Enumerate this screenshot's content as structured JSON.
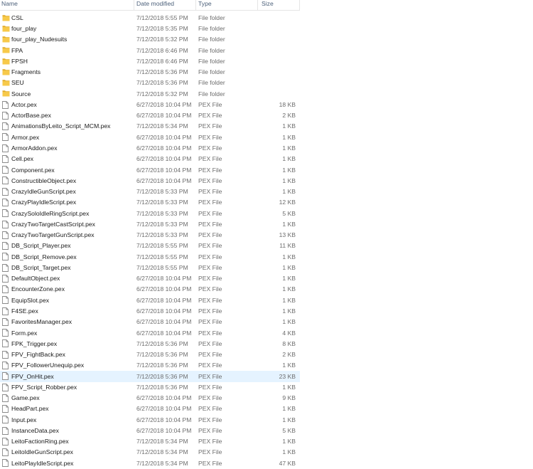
{
  "columns": {
    "name": "Name",
    "date": "Date modified",
    "type": "Type",
    "size": "Size"
  },
  "selected_index": 33,
  "colors": {
    "folder": "#f7c94a",
    "folder_dark": "#e0ab2b",
    "selection": "#e5f3ff"
  },
  "files": [
    {
      "name": "CSL",
      "date": "7/12/2018 5:55 PM",
      "type": "File folder",
      "size": "",
      "kind": "folder"
    },
    {
      "name": "four_play",
      "date": "7/12/2018 5:35 PM",
      "type": "File folder",
      "size": "",
      "kind": "folder"
    },
    {
      "name": "four_play_Nudesuits",
      "date": "7/12/2018 5:32 PM",
      "type": "File folder",
      "size": "",
      "kind": "folder"
    },
    {
      "name": "FPA",
      "date": "7/12/2018 6:46 PM",
      "type": "File folder",
      "size": "",
      "kind": "folder"
    },
    {
      "name": "FPSH",
      "date": "7/12/2018 6:46 PM",
      "type": "File folder",
      "size": "",
      "kind": "folder"
    },
    {
      "name": "Fragments",
      "date": "7/12/2018 5:36 PM",
      "type": "File folder",
      "size": "",
      "kind": "folder"
    },
    {
      "name": "SEU",
      "date": "7/12/2018 5:36 PM",
      "type": "File folder",
      "size": "",
      "kind": "folder"
    },
    {
      "name": "Source",
      "date": "7/12/2018 5:32 PM",
      "type": "File folder",
      "size": "",
      "kind": "folder"
    },
    {
      "name": "Actor.pex",
      "date": "6/27/2018 10:04 PM",
      "type": "PEX File",
      "size": "18 KB",
      "kind": "file"
    },
    {
      "name": "ActorBase.pex",
      "date": "6/27/2018 10:04 PM",
      "type": "PEX File",
      "size": "2 KB",
      "kind": "file"
    },
    {
      "name": "AnimationsByLeito_Script_MCM.pex",
      "date": "7/12/2018 5:34 PM",
      "type": "PEX File",
      "size": "1 KB",
      "kind": "file"
    },
    {
      "name": "Armor.pex",
      "date": "6/27/2018 10:04 PM",
      "type": "PEX File",
      "size": "1 KB",
      "kind": "file"
    },
    {
      "name": "ArmorAddon.pex",
      "date": "6/27/2018 10:04 PM",
      "type": "PEX File",
      "size": "1 KB",
      "kind": "file"
    },
    {
      "name": "Cell.pex",
      "date": "6/27/2018 10:04 PM",
      "type": "PEX File",
      "size": "1 KB",
      "kind": "file"
    },
    {
      "name": "Component.pex",
      "date": "6/27/2018 10:04 PM",
      "type": "PEX File",
      "size": "1 KB",
      "kind": "file"
    },
    {
      "name": "ConstructibleObject.pex",
      "date": "6/27/2018 10:04 PM",
      "type": "PEX File",
      "size": "1 KB",
      "kind": "file"
    },
    {
      "name": "CrazyIdleGunScript.pex",
      "date": "7/12/2018 5:33 PM",
      "type": "PEX File",
      "size": "1 KB",
      "kind": "file"
    },
    {
      "name": "CrazyPlayIdleScript.pex",
      "date": "7/12/2018 5:33 PM",
      "type": "PEX File",
      "size": "12 KB",
      "kind": "file"
    },
    {
      "name": "CrazySoloIdleRingScript.pex",
      "date": "7/12/2018 5:33 PM",
      "type": "PEX File",
      "size": "5 KB",
      "kind": "file"
    },
    {
      "name": "CrazyTwoTargetCastScript.pex",
      "date": "7/12/2018 5:33 PM",
      "type": "PEX File",
      "size": "1 KB",
      "kind": "file"
    },
    {
      "name": "CrazyTwoTargetGunScript.pex",
      "date": "7/12/2018 5:33 PM",
      "type": "PEX File",
      "size": "13 KB",
      "kind": "file"
    },
    {
      "name": "DB_Script_Player.pex",
      "date": "7/12/2018 5:55 PM",
      "type": "PEX File",
      "size": "11 KB",
      "kind": "file"
    },
    {
      "name": "DB_Script_Remove.pex",
      "date": "7/12/2018 5:55 PM",
      "type": "PEX File",
      "size": "1 KB",
      "kind": "file"
    },
    {
      "name": "DB_Script_Target.pex",
      "date": "7/12/2018 5:55 PM",
      "type": "PEX File",
      "size": "1 KB",
      "kind": "file"
    },
    {
      "name": "DefaultObject.pex",
      "date": "6/27/2018 10:04 PM",
      "type": "PEX File",
      "size": "1 KB",
      "kind": "file"
    },
    {
      "name": "EncounterZone.pex",
      "date": "6/27/2018 10:04 PM",
      "type": "PEX File",
      "size": "1 KB",
      "kind": "file"
    },
    {
      "name": "EquipSlot.pex",
      "date": "6/27/2018 10:04 PM",
      "type": "PEX File",
      "size": "1 KB",
      "kind": "file"
    },
    {
      "name": "F4SE.pex",
      "date": "6/27/2018 10:04 PM",
      "type": "PEX File",
      "size": "1 KB",
      "kind": "file"
    },
    {
      "name": "FavoritesManager.pex",
      "date": "6/27/2018 10:04 PM",
      "type": "PEX File",
      "size": "1 KB",
      "kind": "file"
    },
    {
      "name": "Form.pex",
      "date": "6/27/2018 10:04 PM",
      "type": "PEX File",
      "size": "4 KB",
      "kind": "file"
    },
    {
      "name": "FPK_Trigger.pex",
      "date": "7/12/2018 5:36 PM",
      "type": "PEX File",
      "size": "8 KB",
      "kind": "file"
    },
    {
      "name": "FPV_FightBack.pex",
      "date": "7/12/2018 5:36 PM",
      "type": "PEX File",
      "size": "2 KB",
      "kind": "file"
    },
    {
      "name": "FPV_FollowerUnequip.pex",
      "date": "7/12/2018 5:36 PM",
      "type": "PEX File",
      "size": "1 KB",
      "kind": "file"
    },
    {
      "name": "FPV_OnHit.pex",
      "date": "7/12/2018 5:36 PM",
      "type": "PEX File",
      "size": "23 KB",
      "kind": "file"
    },
    {
      "name": "FPV_Script_Robber.pex",
      "date": "7/12/2018 5:36 PM",
      "type": "PEX File",
      "size": "1 KB",
      "kind": "file"
    },
    {
      "name": "Game.pex",
      "date": "6/27/2018 10:04 PM",
      "type": "PEX File",
      "size": "9 KB",
      "kind": "file"
    },
    {
      "name": "HeadPart.pex",
      "date": "6/27/2018 10:04 PM",
      "type": "PEX File",
      "size": "1 KB",
      "kind": "file"
    },
    {
      "name": "Input.pex",
      "date": "6/27/2018 10:04 PM",
      "type": "PEX File",
      "size": "1 KB",
      "kind": "file"
    },
    {
      "name": "InstanceData.pex",
      "date": "6/27/2018 10:04 PM",
      "type": "PEX File",
      "size": "5 KB",
      "kind": "file"
    },
    {
      "name": "LeitoFactionRing.pex",
      "date": "7/12/2018 5:34 PM",
      "type": "PEX File",
      "size": "1 KB",
      "kind": "file"
    },
    {
      "name": "LeitoIdleGunScript.pex",
      "date": "7/12/2018 5:34 PM",
      "type": "PEX File",
      "size": "1 KB",
      "kind": "file"
    },
    {
      "name": "LeitoPlayIdleScript.pex",
      "date": "7/12/2018 5:34 PM",
      "type": "PEX File",
      "size": "47 KB",
      "kind": "file"
    }
  ]
}
